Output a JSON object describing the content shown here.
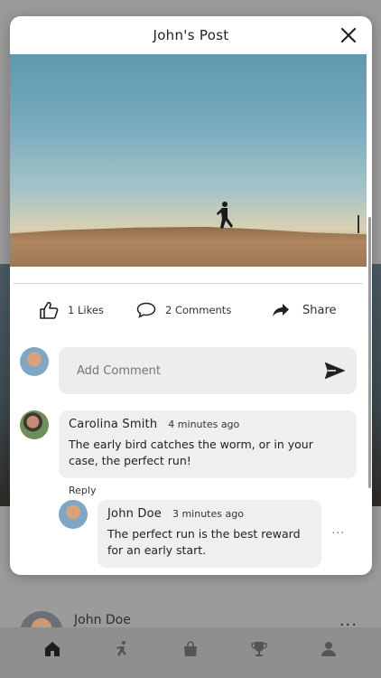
{
  "modal": {
    "title": "John's Post"
  },
  "actions": {
    "likes": "1 Likes",
    "comments": "2 Comments",
    "share": "Share"
  },
  "add_comment": {
    "placeholder": "Add Comment"
  },
  "comments": [
    {
      "author": "Carolina Smith",
      "time": "4 minutes ago",
      "text": "The early bird catches the worm, or in your case, the perfect run!",
      "reply_label": "Reply"
    },
    {
      "author": "John Doe",
      "time": "3 minutes ago",
      "text": "The perfect run is the best reward for an early start.",
      "more": "..."
    }
  ],
  "background": {
    "post_author": "John Doe",
    "more": "..."
  },
  "tabs": [
    "home-icon",
    "run-icon",
    "shop-icon",
    "trophy-icon",
    "profile-icon"
  ],
  "colors": {
    "input_bg": "#ededed",
    "bubble_bg": "#efefef"
  }
}
